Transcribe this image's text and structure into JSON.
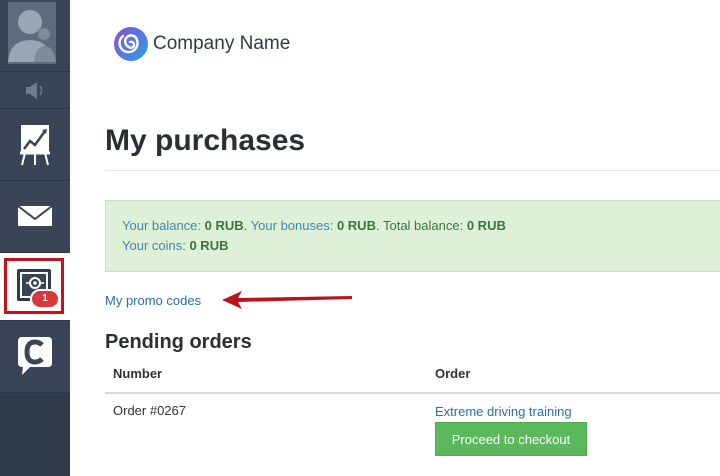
{
  "sidebar": {
    "icons": [
      "user-avatar-icon",
      "speaker-icon",
      "growth-chart-icon",
      "mail-icon",
      "cabinet-settings-icon",
      "chat-c-icon"
    ],
    "notification_badge": "1"
  },
  "header": {
    "company_name": "Company Name"
  },
  "page": {
    "title": "My purchases"
  },
  "balance": {
    "balance_label": "Your balance:",
    "balance_value": "0 RUB",
    "bonuses_label": "Your bonuses:",
    "bonuses_value": "0 RUB",
    "total_label": "Total balance:",
    "total_value": "0 RUB",
    "coins_label": "Your coins:",
    "coins_value": "0 RUB"
  },
  "promo_link": "My promo codes",
  "pending": {
    "title": "Pending orders",
    "columns": [
      "Number",
      "Order"
    ],
    "rows": [
      {
        "number": "Order #0267",
        "order": "Extreme driving training",
        "action": "Proceed to checkout"
      }
    ]
  },
  "colors": {
    "sidebar": "#384557",
    "accent_link": "#2d6ea3",
    "success": "#5cb85c",
    "highlight": "#c0131b",
    "badge": "#d9373c"
  }
}
